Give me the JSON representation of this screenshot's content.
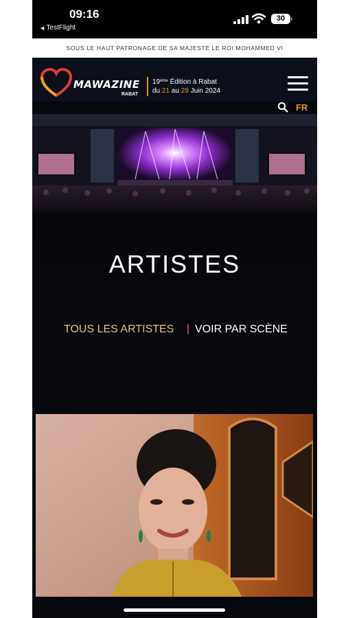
{
  "status": {
    "time": "09:16",
    "back_app": "TestFlight",
    "battery": "30"
  },
  "patronage": "SOUS LE HAUT PATRONAGE DE SA MAJESTÉ LE ROI MOHAMMED VI",
  "header": {
    "logo_text": "MAWAZINE",
    "logo_sub": "RABAT",
    "edition_num": "19",
    "edition_sup": "ème",
    "edition_rest": " Édition à Rabat",
    "dates_du": "du ",
    "dates_start": "21",
    "dates_au": " au ",
    "dates_end": "29",
    "dates_rest": " Juin 2024",
    "language": "FR",
    "icons": [
      "menu-icon",
      "search-icon"
    ]
  },
  "page": {
    "title": "ARTISTES",
    "tabs": [
      {
        "label": "TOUS LES ARTISTES",
        "active": true
      },
      {
        "label": "VOIR PAR SCÈNE",
        "active": false
      }
    ]
  },
  "colors": {
    "accent": "#e8931d",
    "tab_active": "#e8c27a",
    "background": "#06080d",
    "separator": "#b3394f"
  }
}
